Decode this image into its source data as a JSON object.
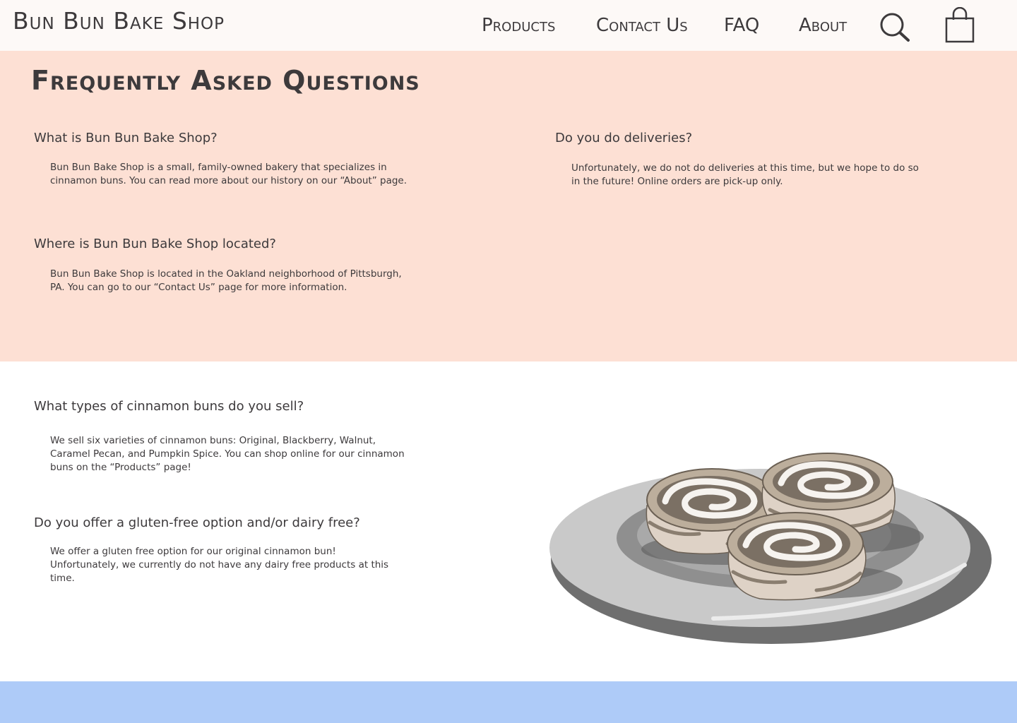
{
  "header": {
    "brand": "Bun Bun Bake Shop",
    "nav": {
      "products": "Products",
      "contact": "Contact Us",
      "faq": "FAQ",
      "about": "About"
    },
    "icons": {
      "search": "search-icon",
      "cart": "shopping-bag-icon"
    }
  },
  "page": {
    "title": "Frequently Asked Questions"
  },
  "faq": [
    {
      "question": "What is Bun Bun Bake Shop?",
      "answer": "Bun Bun Bake Shop is a small, family-owned bakery that specializes in cinnamon buns. You can read more about our history on our “About” page."
    },
    {
      "question": "Do you do deliveries?",
      "answer": "Unfortunately, we do not do deliveries at this time, but we hope to do so in the future! Online orders are pick-up only."
    },
    {
      "question": "Where is Bun Bun Bake Shop located?",
      "answer": "Bun Bun Bake Shop is located in the Oakland neighborhood of Pittsburgh, PA. You can go to our “Contact Us” page for more information."
    },
    {
      "question": "What types of cinnamon buns do you sell?",
      "answer": "We sell six varieties of cinnamon buns: Original, Blackberry, Walnut, Caramel Pecan, and Pumpkin Spice. You can shop online for our cinnamon buns on the “Products” page!"
    },
    {
      "question": "Do you offer a gluten-free option and/or dairy free?",
      "answer": "We offer a gluten free option for our original cinnamon bun! Unfortunately, we currently do not have any dairy free products at this time."
    }
  ],
  "colors": {
    "header_bg": "#fdf9f7",
    "faq_bg": "#fde0d4",
    "footer_bg": "#aecbf8",
    "text": "#3d3a3c"
  }
}
